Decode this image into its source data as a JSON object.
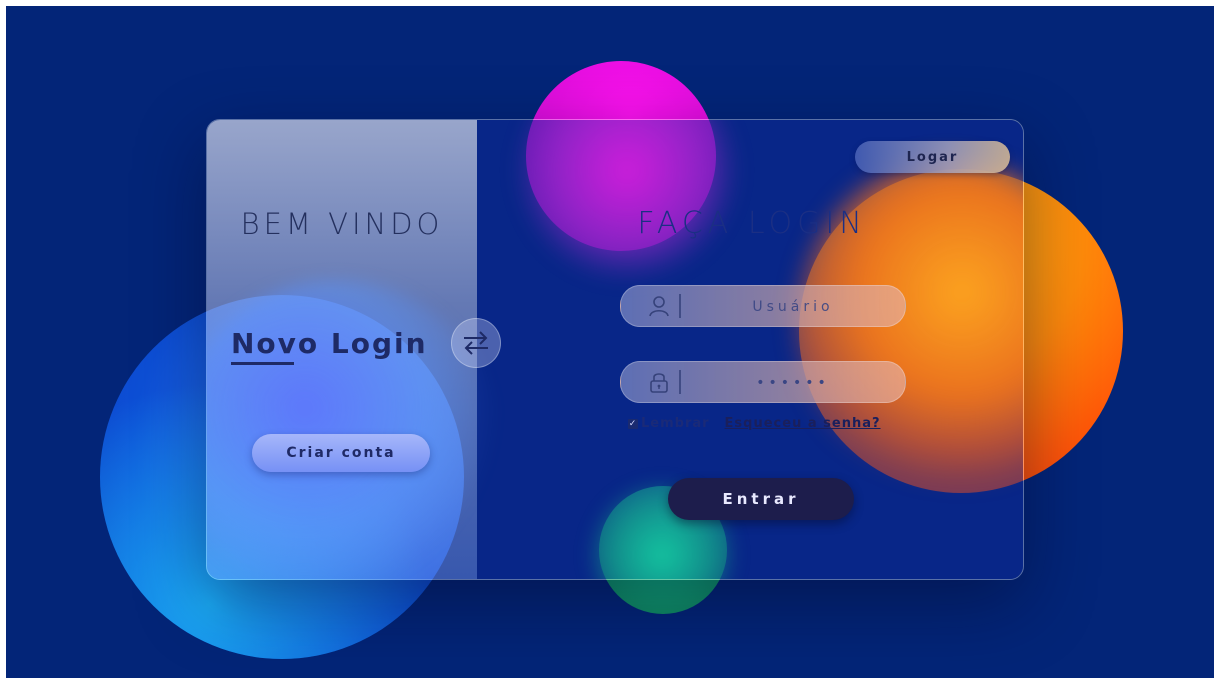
{
  "left_panel": {
    "title": "BEM VINDO",
    "new_login_label": "Novo Login",
    "create_account_button": "Criar conta",
    "swap_icon": "swap-arrows-icon"
  },
  "right_panel": {
    "top_button": "Logar",
    "title": "FAÇA LOGIN",
    "username": {
      "icon": "user-icon",
      "placeholder": "Usuário",
      "value": ""
    },
    "password": {
      "icon": "lock-icon",
      "value": "••••••"
    },
    "remember_label": "Lembrar",
    "forgot_link": "Esqueceu a senha?",
    "submit_button": "Entrar"
  },
  "colors": {
    "background": "#032578",
    "accent_dark": "#1d1d4c",
    "orange": "#ff8a0a",
    "magenta": "#e50ee0",
    "blue": "#1a66e8",
    "green": "#10a978"
  }
}
